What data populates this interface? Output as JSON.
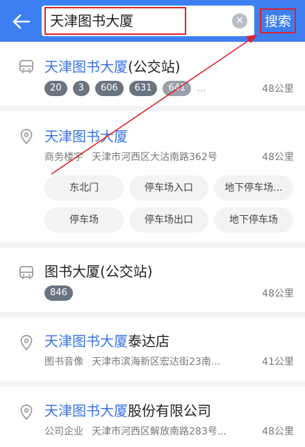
{
  "header": {
    "search_value": "天津图书大厦",
    "search_button": "搜索",
    "icons": {
      "back": "back-arrow-icon",
      "clear": "clear-icon"
    }
  },
  "results": [
    {
      "type": "bus",
      "title_hl": "天津图书大厦",
      "title_rest": "(公交站)",
      "badges": [
        "20",
        "3",
        "606",
        "631",
        "641"
      ],
      "more": "...",
      "distance": "48公里"
    },
    {
      "type": "poi",
      "title_hl": "天津图书大厦",
      "title_rest": "",
      "category": "商务楼宇",
      "address": "天津市河西区大沽南路362号",
      "distance": "48公里",
      "chips": [
        "东北门",
        "停车场入口",
        "地下停车场...",
        "停车场",
        "停车场出口",
        "地下停车场"
      ]
    },
    {
      "type": "bus",
      "title_hl": "",
      "title_rest": "图书大厦(公交站)",
      "badges": [
        "846"
      ],
      "distance": "48公里"
    },
    {
      "type": "poi",
      "title_hl": "天津图书大厦",
      "title_rest": "泰达店",
      "category": "图书音像",
      "address": "天津市滨海新区宏达街23南...",
      "distance": "41公里"
    },
    {
      "type": "poi",
      "title_hl": "天津图书大厦",
      "title_rest": "股份有限公司",
      "category": "公司企业",
      "address": "天津市河西区解放南路283号...",
      "distance": "48公里"
    }
  ],
  "colors": {
    "header_bg": "#3d7ff0",
    "highlight": "#3b74e6",
    "annotation": "#e0202a"
  }
}
